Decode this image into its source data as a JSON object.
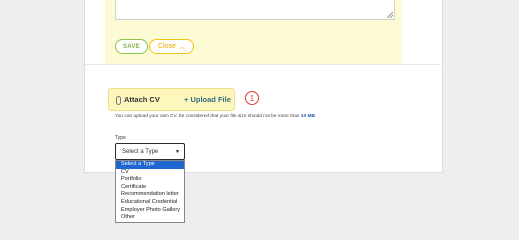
{
  "form": {
    "save_label": "SAVE",
    "close_label": "Close",
    "close_icon": "chevron-up-icon"
  },
  "attach": {
    "title": "Attach CV",
    "clip_icon": "paperclip-icon",
    "upload_label": "+ Upload File",
    "marker": "1"
  },
  "upload_note": {
    "text": "You can upload your own CV, be considered that your file size should not be more than",
    "size": "10 MB"
  },
  "type_select": {
    "label": "Type",
    "value": "Select a Type",
    "options": [
      "Select a Type",
      "CV",
      "Portfolio",
      "Certificate",
      "Recommendation letter",
      "Educational Credential",
      "Employer Photo Gallery",
      "Other"
    ],
    "highlighted_index": 0
  },
  "colors": {
    "save_green": "#8bc34a",
    "close_yellow": "#f1c40f",
    "attach_bg": "#fdf6bd",
    "highlight_blue": "#1e66d0",
    "marker_red": "#e53935"
  }
}
